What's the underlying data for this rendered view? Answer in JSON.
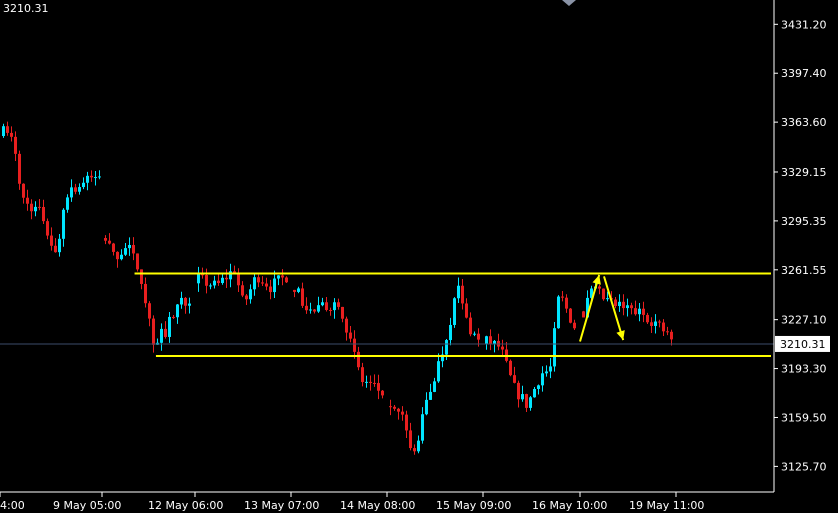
{
  "header": {
    "price_readout": "3210.31"
  },
  "colors": {
    "background": "#000000",
    "bull_candle": "#00e5ff",
    "bear_candle": "#e81f1f",
    "axis": "#ffffff",
    "horizontal_lines": "#ffff00",
    "arrows": "#ffff00",
    "current_price_line": "#3c4c6a",
    "price_label_bg": "#ffffff",
    "price_label_text": "#000000"
  },
  "chart_data": {
    "type": "candlestick",
    "y_range": [
      3108,
      3448
    ],
    "y_ticks": [
      "3431.20",
      "3397.40",
      "3363.60",
      "3329.15",
      "3295.35",
      "3261.55",
      "3227.10",
      "3193.30",
      "3159.50",
      "3125.70"
    ],
    "x_ticks": [
      "4:00",
      "9 May 05:00",
      "12 May 06:00",
      "13 May 07:00",
      "14 May 08:00",
      "15 May 09:00",
      "16 May 10:00",
      "19 May 11:00"
    ],
    "current_price": 3210.31,
    "current_price_label": "3210.31",
    "horizontal_lines": [
      {
        "level": 3259,
        "start_session": 1.35
      },
      {
        "level": 3202,
        "start_session": 1.58
      }
    ],
    "arrows": [
      {
        "from": [
          6.0,
          3212
        ],
        "to": [
          6.2,
          3258
        ],
        "direction": "up"
      },
      {
        "from": [
          6.25,
          3257
        ],
        "to": [
          6.45,
          3213
        ],
        "direction": "down"
      }
    ],
    "sessions_close_path": [
      [
        [
          0,
          3357
        ],
        [
          0.1,
          3350
        ],
        [
          0.2,
          3310
        ],
        [
          0.4,
          3300
        ],
        [
          0.55,
          3270
        ],
        [
          0.65,
          3315
        ],
        [
          0.85,
          3322
        ],
        [
          1.0,
          3327
        ]
      ],
      [
        [
          0,
          3283
        ],
        [
          0.1,
          3270
        ],
        [
          0.25,
          3278
        ],
        [
          0.4,
          3260
        ],
        [
          0.55,
          3212
        ],
        [
          0.7,
          3220
        ],
        [
          0.85,
          3240
        ],
        [
          1.0,
          3242
        ]
      ],
      [
        [
          0,
          3255
        ],
        [
          0.2,
          3250
        ],
        [
          0.4,
          3262
        ],
        [
          0.5,
          3237
        ],
        [
          0.65,
          3258
        ],
        [
          0.8,
          3250
        ],
        [
          1.0,
          3258
        ]
      ],
      [
        [
          0,
          3250
        ],
        [
          0.15,
          3232
        ],
        [
          0.3,
          3235
        ],
        [
          0.5,
          3240
        ],
        [
          0.65,
          3205
        ],
        [
          0.75,
          3185
        ],
        [
          0.85,
          3182
        ],
        [
          1.0,
          3175
        ]
      ],
      [
        [
          0,
          3165
        ],
        [
          0.15,
          3158
        ],
        [
          0.25,
          3130
        ],
        [
          0.4,
          3170
        ],
        [
          0.6,
          3210
        ],
        [
          0.75,
          3250
        ],
        [
          0.85,
          3225
        ],
        [
          1.0,
          3210
        ]
      ],
      [
        [
          0,
          3212
        ],
        [
          0.15,
          3208
        ],
        [
          0.3,
          3180
        ],
        [
          0.45,
          3168
        ],
        [
          0.6,
          3190
        ],
        [
          0.7,
          3192
        ],
        [
          0.8,
          3245
        ],
        [
          1.0,
          3218
        ]
      ],
      [
        [
          0,
          3232
        ],
        [
          0.1,
          3248
        ],
        [
          0.3,
          3238
        ],
        [
          0.5,
          3234
        ],
        [
          0.7,
          3230
        ],
        [
          0.85,
          3222
        ],
        [
          1.0,
          3212
        ]
      ]
    ]
  }
}
